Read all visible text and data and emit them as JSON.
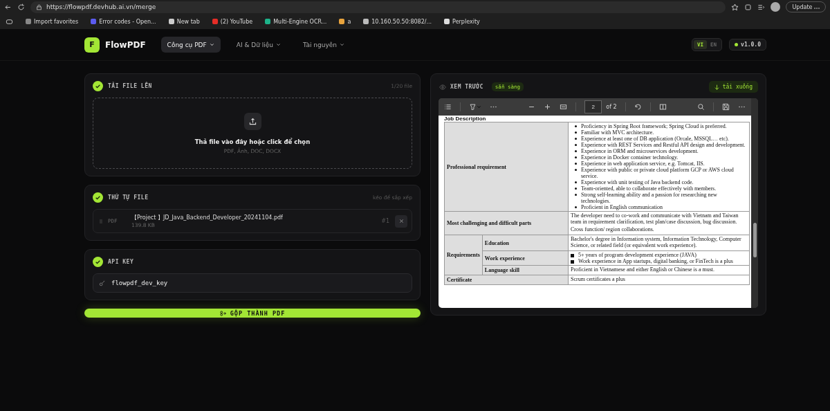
{
  "browser": {
    "url": "https://flowpdf.devhub.ai.vn/merge",
    "update_button": "Update",
    "bookmarks": [
      "Import favorites",
      "Error codes - Open...",
      "New tab",
      "(2) YouTube",
      "Multi-Engine OCR...",
      "a",
      "10.160.50.50:8082/...",
      "Perplexity"
    ]
  },
  "nav": {
    "logo_letter": "F",
    "brand": "FlowPDF",
    "menus": [
      {
        "label": "Công cụ PDF",
        "selected": true
      },
      {
        "label": "AI & Dữ liệu",
        "selected": false
      },
      {
        "label": "Tài nguyên",
        "selected": false
      }
    ],
    "languages": [
      {
        "label": "VI",
        "selected": true
      },
      {
        "label": "EN",
        "selected": false
      }
    ],
    "version": "v1.0.0"
  },
  "upload": {
    "title": "TẢI FILE LÊN",
    "count": "1/20 file",
    "drop_text": "Thả file vào đây hoặc click để chọn",
    "formats": "PDF, Ảnh, DOC, DOCX"
  },
  "order": {
    "title": "THỨ TỰ FILE",
    "hint": "kéo để sắp xếp",
    "files": [
      {
        "type": "PDF",
        "name": "【Project 】JD_Java_Backend_Developer_20241104.pdf",
        "size": "139.8 KB",
        "index": "#1"
      }
    ]
  },
  "api": {
    "title": "API KEY",
    "value": "flowpdf_dev_key"
  },
  "merge_button": "GỘP THÀNH PDF",
  "preview": {
    "title": "XEM TRƯỚC",
    "status": "sẵn sàng",
    "download": "tải xuống",
    "viewer": {
      "page": "2",
      "page_total": "of 2"
    },
    "document": {
      "heading": "Job Description",
      "rows": [
        {
          "label": "Professional requirement",
          "kind": "bullets",
          "items": [
            "Proficiency in Spring Boot framework; Spring Cloud is preferred.",
            "Familiar with MVC architecture.",
            "Experience at least one of DB application (Orcale, MSSQL… etc).",
            "Experience with REST Services and Restful API design and development.",
            "Experience in ORM and microservices development.",
            "Experience in Docker container technology.",
            "Experience in web application service, e.g. Tomcat, IIS.",
            "Experience with public or private cloud platform GCP or AWS cloud service.",
            "Experience with unit testing of Java backend code.",
            "Team-oriented, able to collaborate effectively with members.",
            "Strong self-learning ability and a passion for researching new technologies.",
            "Proficient in English communication"
          ]
        },
        {
          "label": "Most challenging and difficult parts",
          "kind": "paragraphs",
          "items": [
            "The developer need to co-work and communicate with Vietnam and Taiwan team in requirement clarification, test plan/case discussion, bug discussion.",
            "Cross function/ region collaborations."
          ]
        },
        {
          "label": "Requirements",
          "kind": "group",
          "children": [
            {
              "label": "Education",
              "kind": "paragraphs",
              "items": [
                "Bachelor's degree in Information system, Information Technology, Computer Science, or related field (or equivalent work experience)."
              ]
            },
            {
              "label": "Work experience",
              "kind": "squares",
              "items": [
                "5+ years of program development experience (JAVA)",
                "Work experience in App startups, digital banking, or FinTech is a plus"
              ]
            },
            {
              "label": "Language skill",
              "kind": "paragraphs",
              "items": [
                "Proficient in Vietnamese and either English or Chinese is a must."
              ]
            }
          ]
        },
        {
          "label": "Certificate",
          "kind": "paragraphs",
          "items": [
            "Scrum certificates a plus"
          ]
        }
      ]
    }
  }
}
